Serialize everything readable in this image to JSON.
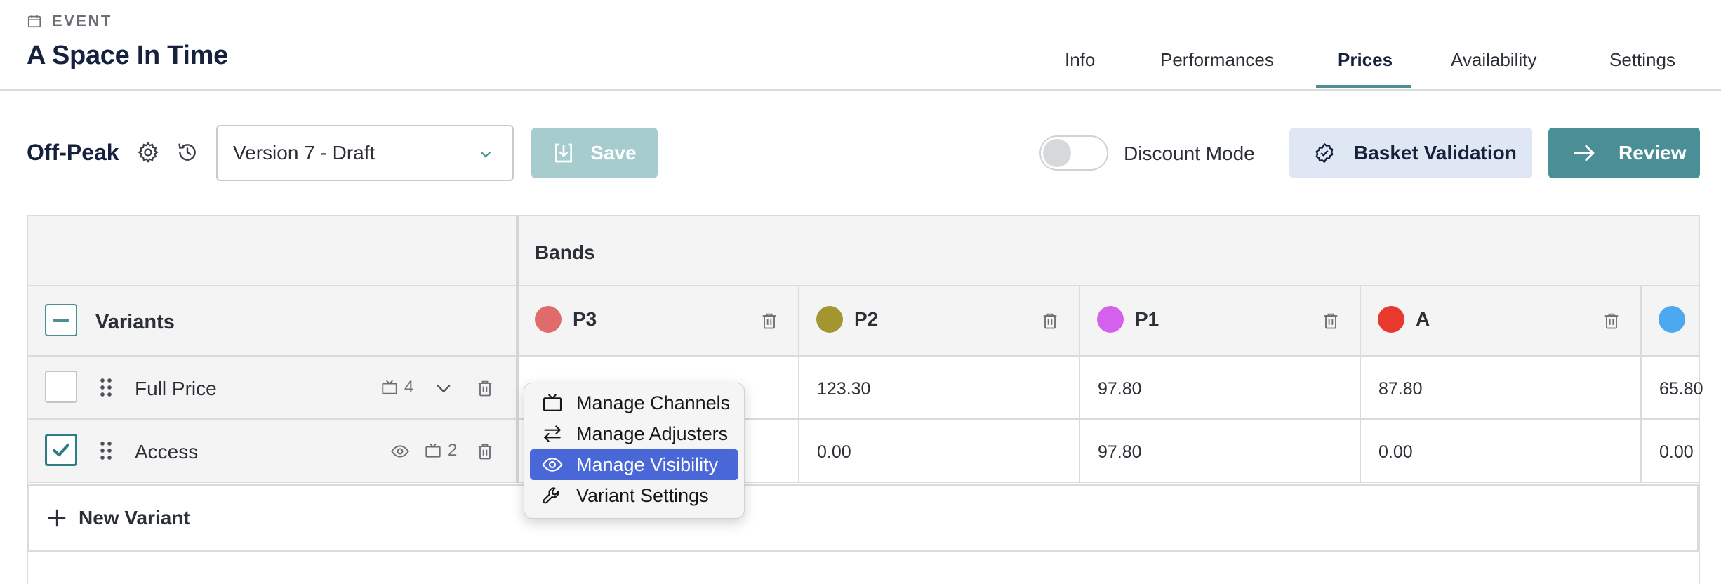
{
  "event": {
    "kicker": "EVENT",
    "title": "A Space In Time",
    "icon": "calendar-icon"
  },
  "tabs": [
    {
      "label": "Info",
      "active": false
    },
    {
      "label": "Performances",
      "active": false
    },
    {
      "label": "Prices",
      "active": true
    },
    {
      "label": "Availability",
      "active": false
    },
    {
      "label": "Settings",
      "active": false
    }
  ],
  "toolbar": {
    "price_list_name": "Off-Peak",
    "version": "Version 7 - Draft",
    "save_label": "Save",
    "save_enabled": false,
    "discount_mode_label": "Discount Mode",
    "discount_mode_on": false,
    "basket_validation_label": "Basket Validation",
    "review_label": "Review"
  },
  "grid": {
    "bands_title": "Bands",
    "variants_title": "Variants",
    "bands": [
      {
        "name": "P3",
        "color": "#e06b6b"
      },
      {
        "name": "P2",
        "color": "#a39530"
      },
      {
        "name": "P1",
        "color": "#d660ee"
      },
      {
        "name": "A",
        "color": "#e8392e"
      },
      {
        "name": "",
        "color": "#4da9ef"
      }
    ],
    "variants": [
      {
        "name": "Full Price",
        "checked": false,
        "channels": "4",
        "visibility_icon": false,
        "prices": [
          "",
          "123.30",
          "97.80",
          "87.80",
          "65.80"
        ]
      },
      {
        "name": "Access",
        "checked": true,
        "channels": "2",
        "visibility_icon": true,
        "prices": [
          "",
          "0.00",
          "97.80",
          "0.00",
          "0.00"
        ]
      }
    ],
    "new_variant_label": "New Variant"
  },
  "context_menu": {
    "items": [
      {
        "label": "Manage Channels",
        "icon": "tv-icon",
        "highlighted": false
      },
      {
        "label": "Manage Adjusters",
        "icon": "arrows-swap-icon",
        "highlighted": false
      },
      {
        "label": "Manage Visibility",
        "icon": "eye-icon",
        "highlighted": true
      },
      {
        "label": "Variant Settings",
        "icon": "wrench-icon",
        "highlighted": false
      }
    ]
  },
  "colors": {
    "accent": "#4a8f96",
    "menu_highlight": "#4a67d8",
    "title": "#15213d"
  }
}
